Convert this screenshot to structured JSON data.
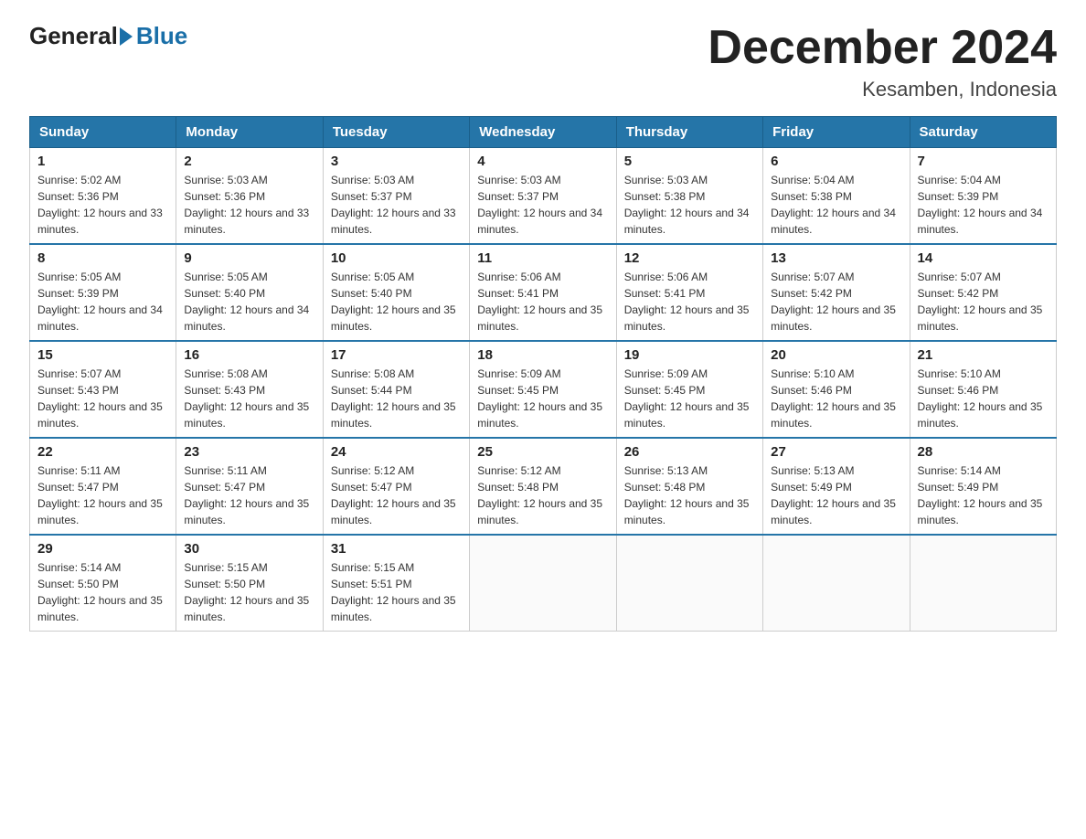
{
  "logo": {
    "general": "General",
    "blue": "Blue"
  },
  "title": "December 2024",
  "location": "Kesamben, Indonesia",
  "days_of_week": [
    "Sunday",
    "Monday",
    "Tuesday",
    "Wednesday",
    "Thursday",
    "Friday",
    "Saturday"
  ],
  "weeks": [
    [
      {
        "num": "1",
        "sunrise": "Sunrise: 5:02 AM",
        "sunset": "Sunset: 5:36 PM",
        "daylight": "Daylight: 12 hours and 33 minutes."
      },
      {
        "num": "2",
        "sunrise": "Sunrise: 5:03 AM",
        "sunset": "Sunset: 5:36 PM",
        "daylight": "Daylight: 12 hours and 33 minutes."
      },
      {
        "num": "3",
        "sunrise": "Sunrise: 5:03 AM",
        "sunset": "Sunset: 5:37 PM",
        "daylight": "Daylight: 12 hours and 33 minutes."
      },
      {
        "num": "4",
        "sunrise": "Sunrise: 5:03 AM",
        "sunset": "Sunset: 5:37 PM",
        "daylight": "Daylight: 12 hours and 34 minutes."
      },
      {
        "num": "5",
        "sunrise": "Sunrise: 5:03 AM",
        "sunset": "Sunset: 5:38 PM",
        "daylight": "Daylight: 12 hours and 34 minutes."
      },
      {
        "num": "6",
        "sunrise": "Sunrise: 5:04 AM",
        "sunset": "Sunset: 5:38 PM",
        "daylight": "Daylight: 12 hours and 34 minutes."
      },
      {
        "num": "7",
        "sunrise": "Sunrise: 5:04 AM",
        "sunset": "Sunset: 5:39 PM",
        "daylight": "Daylight: 12 hours and 34 minutes."
      }
    ],
    [
      {
        "num": "8",
        "sunrise": "Sunrise: 5:05 AM",
        "sunset": "Sunset: 5:39 PM",
        "daylight": "Daylight: 12 hours and 34 minutes."
      },
      {
        "num": "9",
        "sunrise": "Sunrise: 5:05 AM",
        "sunset": "Sunset: 5:40 PM",
        "daylight": "Daylight: 12 hours and 34 minutes."
      },
      {
        "num": "10",
        "sunrise": "Sunrise: 5:05 AM",
        "sunset": "Sunset: 5:40 PM",
        "daylight": "Daylight: 12 hours and 35 minutes."
      },
      {
        "num": "11",
        "sunrise": "Sunrise: 5:06 AM",
        "sunset": "Sunset: 5:41 PM",
        "daylight": "Daylight: 12 hours and 35 minutes."
      },
      {
        "num": "12",
        "sunrise": "Sunrise: 5:06 AM",
        "sunset": "Sunset: 5:41 PM",
        "daylight": "Daylight: 12 hours and 35 minutes."
      },
      {
        "num": "13",
        "sunrise": "Sunrise: 5:07 AM",
        "sunset": "Sunset: 5:42 PM",
        "daylight": "Daylight: 12 hours and 35 minutes."
      },
      {
        "num": "14",
        "sunrise": "Sunrise: 5:07 AM",
        "sunset": "Sunset: 5:42 PM",
        "daylight": "Daylight: 12 hours and 35 minutes."
      }
    ],
    [
      {
        "num": "15",
        "sunrise": "Sunrise: 5:07 AM",
        "sunset": "Sunset: 5:43 PM",
        "daylight": "Daylight: 12 hours and 35 minutes."
      },
      {
        "num": "16",
        "sunrise": "Sunrise: 5:08 AM",
        "sunset": "Sunset: 5:43 PM",
        "daylight": "Daylight: 12 hours and 35 minutes."
      },
      {
        "num": "17",
        "sunrise": "Sunrise: 5:08 AM",
        "sunset": "Sunset: 5:44 PM",
        "daylight": "Daylight: 12 hours and 35 minutes."
      },
      {
        "num": "18",
        "sunrise": "Sunrise: 5:09 AM",
        "sunset": "Sunset: 5:45 PM",
        "daylight": "Daylight: 12 hours and 35 minutes."
      },
      {
        "num": "19",
        "sunrise": "Sunrise: 5:09 AM",
        "sunset": "Sunset: 5:45 PM",
        "daylight": "Daylight: 12 hours and 35 minutes."
      },
      {
        "num": "20",
        "sunrise": "Sunrise: 5:10 AM",
        "sunset": "Sunset: 5:46 PM",
        "daylight": "Daylight: 12 hours and 35 minutes."
      },
      {
        "num": "21",
        "sunrise": "Sunrise: 5:10 AM",
        "sunset": "Sunset: 5:46 PM",
        "daylight": "Daylight: 12 hours and 35 minutes."
      }
    ],
    [
      {
        "num": "22",
        "sunrise": "Sunrise: 5:11 AM",
        "sunset": "Sunset: 5:47 PM",
        "daylight": "Daylight: 12 hours and 35 minutes."
      },
      {
        "num": "23",
        "sunrise": "Sunrise: 5:11 AM",
        "sunset": "Sunset: 5:47 PM",
        "daylight": "Daylight: 12 hours and 35 minutes."
      },
      {
        "num": "24",
        "sunrise": "Sunrise: 5:12 AM",
        "sunset": "Sunset: 5:47 PM",
        "daylight": "Daylight: 12 hours and 35 minutes."
      },
      {
        "num": "25",
        "sunrise": "Sunrise: 5:12 AM",
        "sunset": "Sunset: 5:48 PM",
        "daylight": "Daylight: 12 hours and 35 minutes."
      },
      {
        "num": "26",
        "sunrise": "Sunrise: 5:13 AM",
        "sunset": "Sunset: 5:48 PM",
        "daylight": "Daylight: 12 hours and 35 minutes."
      },
      {
        "num": "27",
        "sunrise": "Sunrise: 5:13 AM",
        "sunset": "Sunset: 5:49 PM",
        "daylight": "Daylight: 12 hours and 35 minutes."
      },
      {
        "num": "28",
        "sunrise": "Sunrise: 5:14 AM",
        "sunset": "Sunset: 5:49 PM",
        "daylight": "Daylight: 12 hours and 35 minutes."
      }
    ],
    [
      {
        "num": "29",
        "sunrise": "Sunrise: 5:14 AM",
        "sunset": "Sunset: 5:50 PM",
        "daylight": "Daylight: 12 hours and 35 minutes."
      },
      {
        "num": "30",
        "sunrise": "Sunrise: 5:15 AM",
        "sunset": "Sunset: 5:50 PM",
        "daylight": "Daylight: 12 hours and 35 minutes."
      },
      {
        "num": "31",
        "sunrise": "Sunrise: 5:15 AM",
        "sunset": "Sunset: 5:51 PM",
        "daylight": "Daylight: 12 hours and 35 minutes."
      },
      null,
      null,
      null,
      null
    ]
  ]
}
